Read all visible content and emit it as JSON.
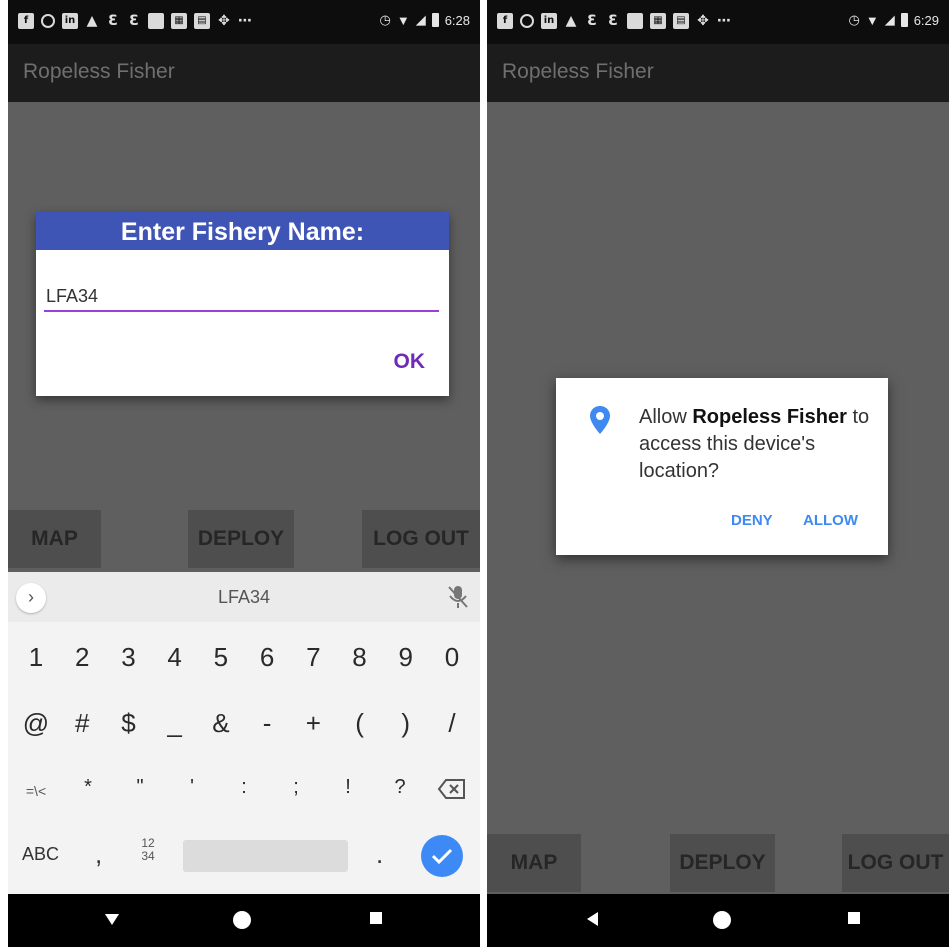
{
  "app": {
    "title": "Ropeless Fisher"
  },
  "left_screen": {
    "status": {
      "time": "6:28"
    },
    "dialog": {
      "title": "Enter Fishery Name:",
      "input_value": "LFA34",
      "ok_label": "OK"
    },
    "buttons": {
      "map": "MAP",
      "deploy": "DEPLOY",
      "logout": "LOG OUT"
    },
    "keyboard": {
      "suggestion": "LFA34",
      "row1": [
        "1",
        "2",
        "3",
        "4",
        "5",
        "6",
        "7",
        "8",
        "9",
        "0"
      ],
      "row2": [
        "@",
        "#",
        "$",
        "_",
        "&",
        "-",
        "+",
        "(",
        ")",
        "/"
      ],
      "row3": [
        "=\\<",
        "*",
        "\"",
        "'",
        ":",
        ";",
        "!",
        "?"
      ],
      "abc": "ABC",
      "comma": ",",
      "numpad_top": "12",
      "numpad_bottom": "34",
      "period": "."
    }
  },
  "right_screen": {
    "status": {
      "time": "6:29"
    },
    "permission_dialog": {
      "prefix": "Allow",
      "app_name": "Ropeless Fisher",
      "message": "to access this device's location?",
      "deny": "DENY",
      "allow": "ALLOW"
    },
    "buttons": {
      "map": "MAP",
      "deploy": "DEPLOY",
      "logout": "LOG OUT"
    }
  },
  "colors": {
    "dialog_header": "#3f55b5",
    "ok_button": "#6e2bb5",
    "input_underline": "#9b40d6",
    "permission_action": "#3f8af0",
    "keyboard_enter": "#3d8af7"
  }
}
